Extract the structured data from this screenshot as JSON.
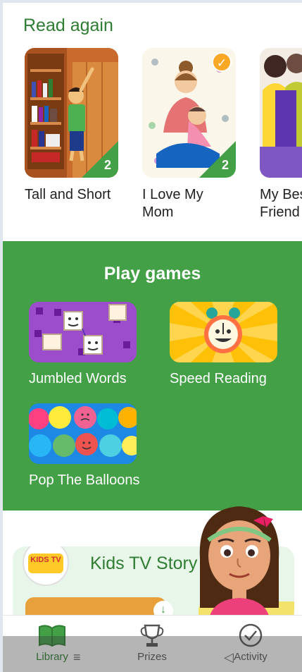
{
  "read_again": {
    "title": "Read again",
    "books": [
      {
        "title": "Tall and Short",
        "count": "2",
        "checked": false
      },
      {
        "title": "I Love My Mom",
        "count": "2",
        "checked": true
      },
      {
        "title": "My Best Friend",
        "count": "",
        "checked": false
      }
    ]
  },
  "play_games": {
    "title": "Play games",
    "games": [
      {
        "label": "Jumbled Words"
      },
      {
        "label": "Speed Reading"
      },
      {
        "label": "Pop The Balloons"
      }
    ]
  },
  "channel": {
    "name": "Kids TV Story",
    "logo_text": "KIDS TV"
  },
  "bottom_nav": [
    {
      "label": "Library",
      "icon": "book-icon",
      "active": true
    },
    {
      "label": "Prizes",
      "icon": "trophy-icon",
      "active": false
    },
    {
      "label": "Activity",
      "icon": "activity-icon",
      "active": false
    }
  ],
  "system_nav": {
    "menu": "≡",
    "back": "◁"
  },
  "colors": {
    "brand_green": "#43a047",
    "title_green": "#2e7d32",
    "badge_orange": "#f9a825"
  }
}
